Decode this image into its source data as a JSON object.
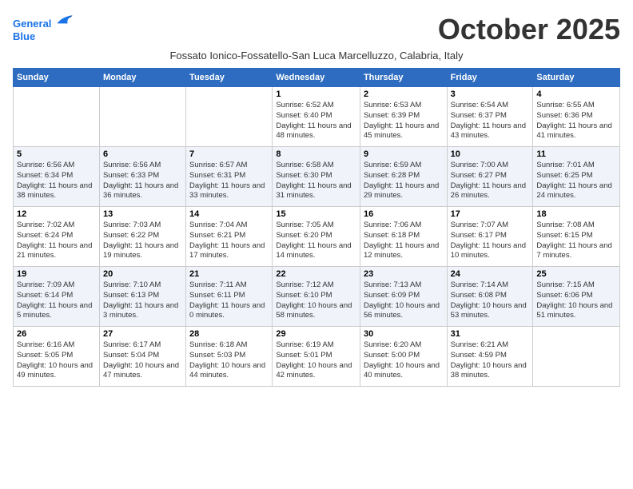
{
  "header": {
    "logo_line1": "General",
    "logo_line2": "Blue",
    "month_title": "October 2025",
    "location": "Fossato Ionico-Fossatello-San Luca Marcelluzzo, Calabria, Italy"
  },
  "weekdays": [
    "Sunday",
    "Monday",
    "Tuesday",
    "Wednesday",
    "Thursday",
    "Friday",
    "Saturday"
  ],
  "weeks": [
    [
      {
        "day": "",
        "sunrise": "",
        "sunset": "",
        "daylight": ""
      },
      {
        "day": "",
        "sunrise": "",
        "sunset": "",
        "daylight": ""
      },
      {
        "day": "",
        "sunrise": "",
        "sunset": "",
        "daylight": ""
      },
      {
        "day": "1",
        "sunrise": "Sunrise: 6:52 AM",
        "sunset": "Sunset: 6:40 PM",
        "daylight": "Daylight: 11 hours and 48 minutes."
      },
      {
        "day": "2",
        "sunrise": "Sunrise: 6:53 AM",
        "sunset": "Sunset: 6:39 PM",
        "daylight": "Daylight: 11 hours and 45 minutes."
      },
      {
        "day": "3",
        "sunrise": "Sunrise: 6:54 AM",
        "sunset": "Sunset: 6:37 PM",
        "daylight": "Daylight: 11 hours and 43 minutes."
      },
      {
        "day": "4",
        "sunrise": "Sunrise: 6:55 AM",
        "sunset": "Sunset: 6:36 PM",
        "daylight": "Daylight: 11 hours and 41 minutes."
      }
    ],
    [
      {
        "day": "5",
        "sunrise": "Sunrise: 6:56 AM",
        "sunset": "Sunset: 6:34 PM",
        "daylight": "Daylight: 11 hours and 38 minutes."
      },
      {
        "day": "6",
        "sunrise": "Sunrise: 6:56 AM",
        "sunset": "Sunset: 6:33 PM",
        "daylight": "Daylight: 11 hours and 36 minutes."
      },
      {
        "day": "7",
        "sunrise": "Sunrise: 6:57 AM",
        "sunset": "Sunset: 6:31 PM",
        "daylight": "Daylight: 11 hours and 33 minutes."
      },
      {
        "day": "8",
        "sunrise": "Sunrise: 6:58 AM",
        "sunset": "Sunset: 6:30 PM",
        "daylight": "Daylight: 11 hours and 31 minutes."
      },
      {
        "day": "9",
        "sunrise": "Sunrise: 6:59 AM",
        "sunset": "Sunset: 6:28 PM",
        "daylight": "Daylight: 11 hours and 29 minutes."
      },
      {
        "day": "10",
        "sunrise": "Sunrise: 7:00 AM",
        "sunset": "Sunset: 6:27 PM",
        "daylight": "Daylight: 11 hours and 26 minutes."
      },
      {
        "day": "11",
        "sunrise": "Sunrise: 7:01 AM",
        "sunset": "Sunset: 6:25 PM",
        "daylight": "Daylight: 11 hours and 24 minutes."
      }
    ],
    [
      {
        "day": "12",
        "sunrise": "Sunrise: 7:02 AM",
        "sunset": "Sunset: 6:24 PM",
        "daylight": "Daylight: 11 hours and 21 minutes."
      },
      {
        "day": "13",
        "sunrise": "Sunrise: 7:03 AM",
        "sunset": "Sunset: 6:22 PM",
        "daylight": "Daylight: 11 hours and 19 minutes."
      },
      {
        "day": "14",
        "sunrise": "Sunrise: 7:04 AM",
        "sunset": "Sunset: 6:21 PM",
        "daylight": "Daylight: 11 hours and 17 minutes."
      },
      {
        "day": "15",
        "sunrise": "Sunrise: 7:05 AM",
        "sunset": "Sunset: 6:20 PM",
        "daylight": "Daylight: 11 hours and 14 minutes."
      },
      {
        "day": "16",
        "sunrise": "Sunrise: 7:06 AM",
        "sunset": "Sunset: 6:18 PM",
        "daylight": "Daylight: 11 hours and 12 minutes."
      },
      {
        "day": "17",
        "sunrise": "Sunrise: 7:07 AM",
        "sunset": "Sunset: 6:17 PM",
        "daylight": "Daylight: 11 hours and 10 minutes."
      },
      {
        "day": "18",
        "sunrise": "Sunrise: 7:08 AM",
        "sunset": "Sunset: 6:15 PM",
        "daylight": "Daylight: 11 hours and 7 minutes."
      }
    ],
    [
      {
        "day": "19",
        "sunrise": "Sunrise: 7:09 AM",
        "sunset": "Sunset: 6:14 PM",
        "daylight": "Daylight: 11 hours and 5 minutes."
      },
      {
        "day": "20",
        "sunrise": "Sunrise: 7:10 AM",
        "sunset": "Sunset: 6:13 PM",
        "daylight": "Daylight: 11 hours and 3 minutes."
      },
      {
        "day": "21",
        "sunrise": "Sunrise: 7:11 AM",
        "sunset": "Sunset: 6:11 PM",
        "daylight": "Daylight: 11 hours and 0 minutes."
      },
      {
        "day": "22",
        "sunrise": "Sunrise: 7:12 AM",
        "sunset": "Sunset: 6:10 PM",
        "daylight": "Daylight: 10 hours and 58 minutes."
      },
      {
        "day": "23",
        "sunrise": "Sunrise: 7:13 AM",
        "sunset": "Sunset: 6:09 PM",
        "daylight": "Daylight: 10 hours and 56 minutes."
      },
      {
        "day": "24",
        "sunrise": "Sunrise: 7:14 AM",
        "sunset": "Sunset: 6:08 PM",
        "daylight": "Daylight: 10 hours and 53 minutes."
      },
      {
        "day": "25",
        "sunrise": "Sunrise: 7:15 AM",
        "sunset": "Sunset: 6:06 PM",
        "daylight": "Daylight: 10 hours and 51 minutes."
      }
    ],
    [
      {
        "day": "26",
        "sunrise": "Sunrise: 6:16 AM",
        "sunset": "Sunset: 5:05 PM",
        "daylight": "Daylight: 10 hours and 49 minutes."
      },
      {
        "day": "27",
        "sunrise": "Sunrise: 6:17 AM",
        "sunset": "Sunset: 5:04 PM",
        "daylight": "Daylight: 10 hours and 47 minutes."
      },
      {
        "day": "28",
        "sunrise": "Sunrise: 6:18 AM",
        "sunset": "Sunset: 5:03 PM",
        "daylight": "Daylight: 10 hours and 44 minutes."
      },
      {
        "day": "29",
        "sunrise": "Sunrise: 6:19 AM",
        "sunset": "Sunset: 5:01 PM",
        "daylight": "Daylight: 10 hours and 42 minutes."
      },
      {
        "day": "30",
        "sunrise": "Sunrise: 6:20 AM",
        "sunset": "Sunset: 5:00 PM",
        "daylight": "Daylight: 10 hours and 40 minutes."
      },
      {
        "day": "31",
        "sunrise": "Sunrise: 6:21 AM",
        "sunset": "Sunset: 4:59 PM",
        "daylight": "Daylight: 10 hours and 38 minutes."
      },
      {
        "day": "",
        "sunrise": "",
        "sunset": "",
        "daylight": ""
      }
    ]
  ]
}
